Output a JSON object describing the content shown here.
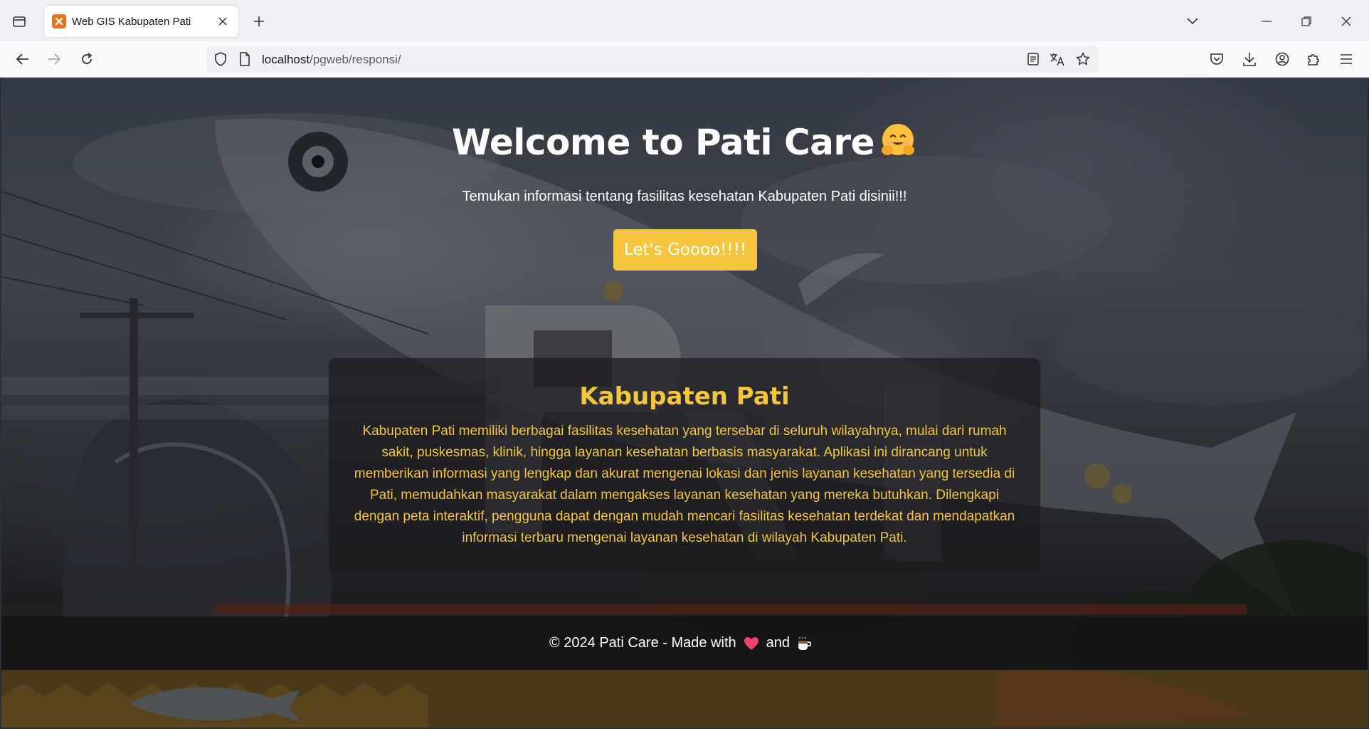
{
  "browser": {
    "tab_title": "Web GIS Kabupaten Pati",
    "url_host": "localhost",
    "url_path": "/pgweb/responsi/"
  },
  "hero": {
    "title": "Welcome to Pati Care",
    "title_emoji": "hugging-face-emoji",
    "subtitle": "Temukan informasi tentang fasilitas kesehatan Kabupaten Pati disinii!!!",
    "cta_label": "Let's Goooo!!!!"
  },
  "card": {
    "title": "Kabupaten Pati",
    "text": "Kabupaten Pati memiliki berbagai fasilitas kesehatan yang tersebar di seluruh wilayahnya, mulai dari rumah sakit, puskesmas, klinik, hingga layanan kesehatan berbasis masyarakat. Aplikasi ini dirancang untuk memberikan informasi yang lengkap dan akurat mengenai lokasi dan jenis layanan kesehatan yang tersedia di Pati, memudahkan masyarakat dalam mengakses layanan kesehatan yang mereka butuhkan. Dilengkapi dengan peta interaktif, pengguna dapat dengan mudah mencari fasilitas kesehatan terdekat dan mendapatkan informasi terbaru mengenai layanan kesehatan di wilayah Kabupaten Pati."
  },
  "footer": {
    "text_before": "© 2024 Pati Care - Made with",
    "text_middle": "and",
    "icons": [
      "heart-icon",
      "coffee-icon"
    ]
  },
  "colors": {
    "accent": "#f4c53d",
    "text_light": "#ffffff"
  }
}
